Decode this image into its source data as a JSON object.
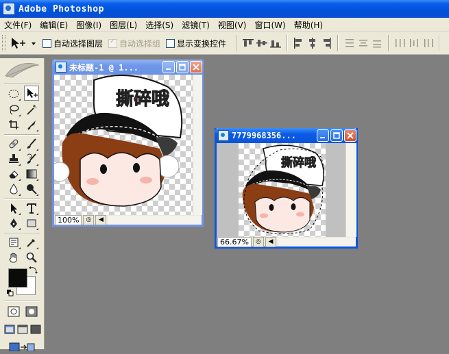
{
  "app": {
    "title": "Adobe Photoshop"
  },
  "menu": [
    {
      "label": "文件(F)"
    },
    {
      "label": "编辑(E)"
    },
    {
      "label": "图像(I)"
    },
    {
      "label": "图层(L)"
    },
    {
      "label": "选择(S)"
    },
    {
      "label": "滤镜(T)"
    },
    {
      "label": "视图(V)"
    },
    {
      "label": "窗口(W)"
    },
    {
      "label": "帮助(H)"
    }
  ],
  "options": {
    "auto_select_layer": "自动选择图层",
    "auto_select_group": "自动选择组",
    "show_transform_controls": "显示变换控件"
  },
  "documents": [
    {
      "title": "未标题-1 @ 1...",
      "zoom": "100%"
    },
    {
      "title": "7779968356...",
      "zoom": "66.67%"
    }
  ],
  "artwork": {
    "logo_text": "撕碎哦"
  },
  "colors": {
    "foreground": "#0b0b0b",
    "background": "#ffffff",
    "workspace": "#7f7f7f"
  }
}
